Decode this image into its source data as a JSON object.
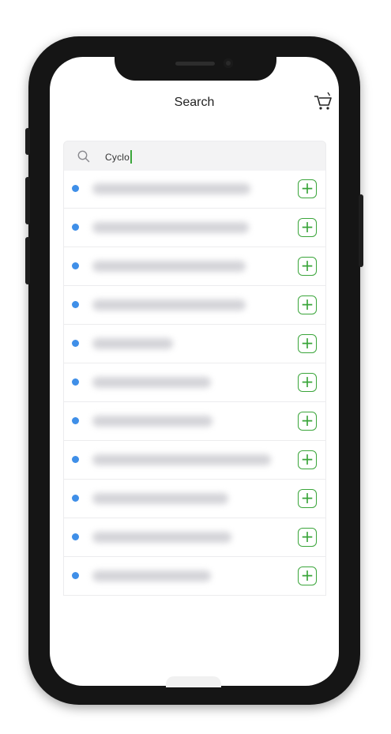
{
  "header": {
    "title": "Search"
  },
  "search": {
    "value": "Cyclo"
  },
  "icons": {
    "cart": "cart-icon",
    "search": "search-icon",
    "add": "plus-icon"
  },
  "colors": {
    "accent_green": "#3aa53a",
    "dot_blue": "#3f8fe8"
  },
  "results": {
    "add_label": "+",
    "count": 11
  }
}
